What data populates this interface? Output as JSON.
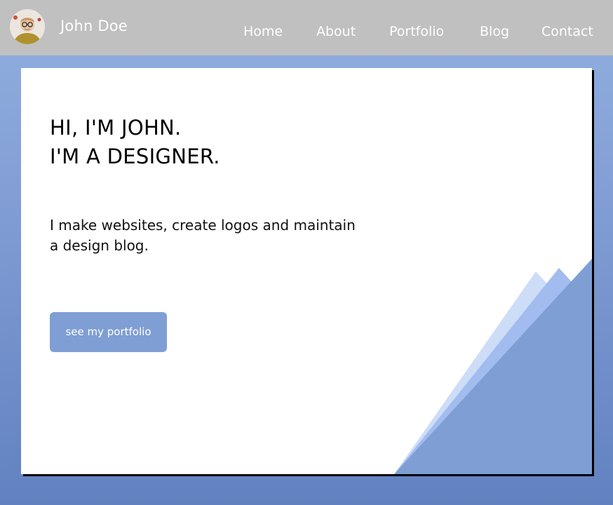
{
  "header": {
    "name": "John Doe",
    "avatar_icon": "avatar-photo-icon",
    "nav": [
      "Home",
      "About",
      "Portfolio",
      "Blog",
      "Contact"
    ]
  },
  "hero": {
    "headline_line1": "HI, I'M JOHN.",
    "headline_line2": "I'M A DESIGNER.",
    "intro": "I make websites, create logos and maintain a design blog.",
    "cta_label": "see my portfolio"
  },
  "colors": {
    "topbar": "#c0c0c0",
    "background_top": "#93b0e0",
    "background_bottom": "#6181c0",
    "accent": "#7f9ed4"
  }
}
